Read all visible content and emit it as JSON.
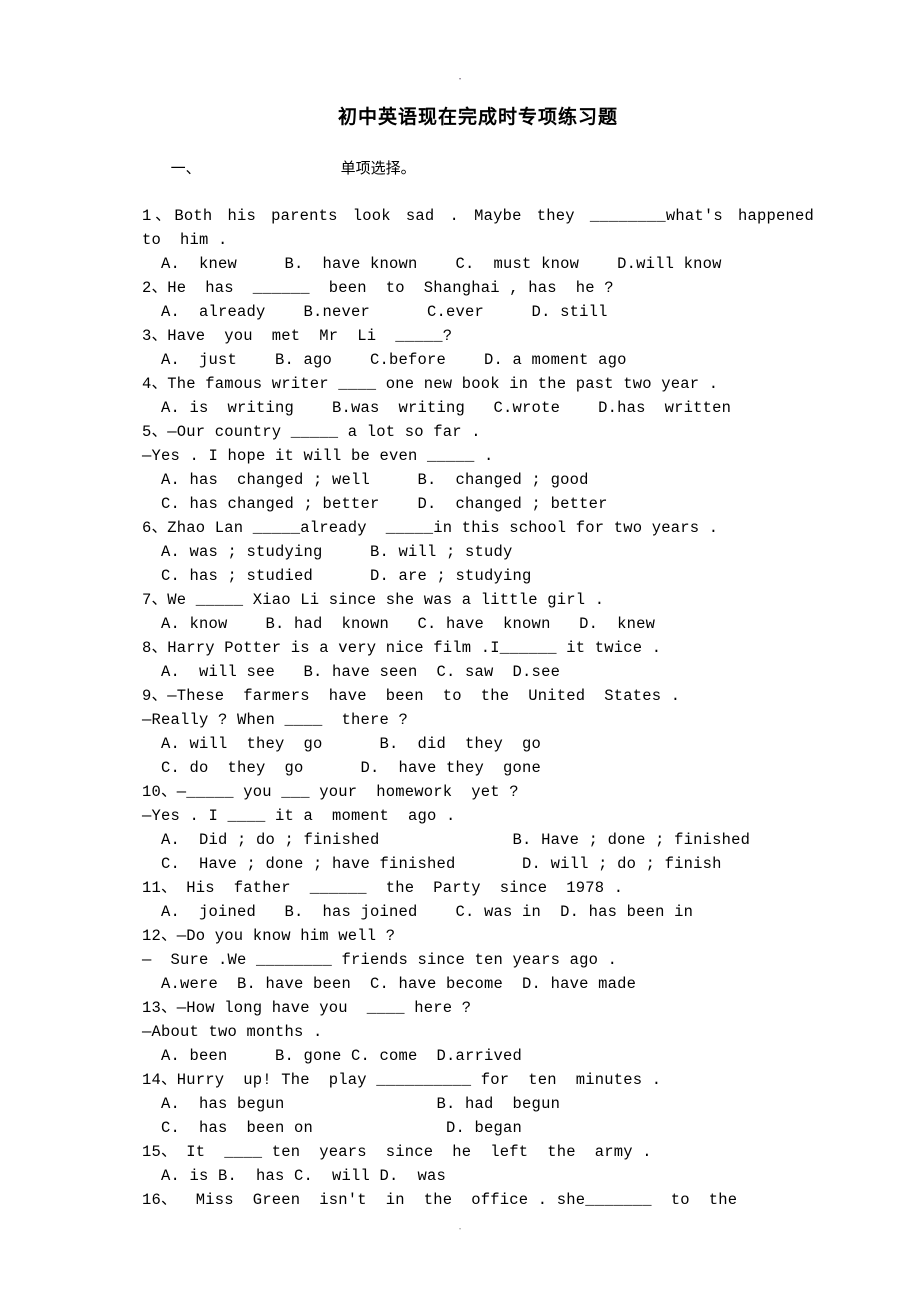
{
  "page": {
    "top_mark": "·",
    "bottom_mark": "·",
    "title": "初中英语现在完成时专项练习题",
    "section_number": "一、",
    "section_label": "单项选择。"
  },
  "questions": [
    {
      "number": "1、",
      "stem_line1": "1、Both  his  parents  look  sad . Maybe  they  ________what's  happened",
      "stem_line2": "to  him .",
      "options_lines": [
        "  A.  knew     B.  have known    C.  must know    D.will know"
      ]
    },
    {
      "number": "2、",
      "stem_line1": "2、He  has  ______  been  to  Shanghai , has  he ?",
      "options_lines": [
        "  A.  already    B.never      C.ever     D. still"
      ]
    },
    {
      "number": "3、",
      "stem_line1": "3、Have  you  met  Mr  Li  _____?",
      "options_lines": [
        "  A.  just    B. ago    C.before    D. a moment ago"
      ]
    },
    {
      "number": "4、",
      "stem_line1": "4、The famous writer ____ one new book in the past two year .",
      "options_lines": [
        "  A. is  writing    B.was  writing   C.wrote    D.has  written"
      ]
    },
    {
      "number": "5、",
      "stem_line1": "5、—Our country _____ a lot so far .",
      "stem_line2": "—Yes . I hope it will be even _____ .",
      "options_lines": [
        "  A. has  changed ; well     B.  changed ; good",
        "  C. has changed ; better    D.  changed ; better"
      ]
    },
    {
      "number": "6、",
      "stem_line1": "6、Zhao Lan _____already  _____in this school for two years .",
      "options_lines": [
        "  A. was ; studying     B. will ; study",
        "  C. has ; studied      D. are ; studying"
      ]
    },
    {
      "number": "7、",
      "stem_line1": "7、We _____ Xiao Li since she was a little girl .",
      "options_lines": [
        "  A. know    B. had  known   C. have  known   D.  knew"
      ]
    },
    {
      "number": "8、",
      "stem_line1": "8、Harry Potter is a very nice film .I______ it twice .",
      "options_lines": [
        "  A.  will see   B. have seen  C. saw  D.see"
      ]
    },
    {
      "number": "9、",
      "stem_line1": "9、—These  farmers  have  been  to  the  United  States .",
      "stem_line2": "—Really ? When ____  there ?",
      "options_lines": [
        "  A. will  they  go      B.  did  they  go",
        "  C. do  they  go      D.  have they  gone"
      ]
    },
    {
      "number": "10、",
      "stem_line1": "10、—_____ you ___ your  homework  yet ?",
      "stem_line2": "—Yes . I ____ it a  moment  ago .",
      "options_lines": [
        "  A.  Did ; do ; finished              B. Have ; done ; finished",
        "  C.  Have ; done ; have finished       D. will ; do ; finish"
      ]
    },
    {
      "number": "11、",
      "stem_line1": "11、 His  father  ______  the  Party  since  1978 .",
      "options_lines": [
        "  A.  joined   B.  has joined    C. was in  D. has been in"
      ]
    },
    {
      "number": "12、",
      "stem_line1": "12、—Do you know him well ?",
      "stem_line2": "—  Sure .We ________ friends since ten years ago .",
      "options_lines": [
        "  A.were  B. have been  C. have become  D. have made"
      ]
    },
    {
      "number": "13、",
      "stem_line1": "13、—How long have you  ____ here ?",
      "stem_line2": "—About two months .",
      "options_lines": [
        "  A. been     B. gone C. come  D.arrived"
      ]
    },
    {
      "number": "14、",
      "stem_line1": "14、Hurry  up! The  play __________ for  ten  minutes .",
      "options_lines": [
        "  A.  has begun                B. had  begun",
        "  C.  has  been on              D. began"
      ]
    },
    {
      "number": "15、",
      "stem_line1": "15、 It  ____ ten  years  since  he  left  the  army .",
      "options_lines": [
        "  A. is B.  has C.  will D.  was"
      ]
    },
    {
      "number": "16、",
      "stem_line1": "16、  Miss  Green  isn't  in  the  office . she_______  to  the",
      "options_lines": []
    }
  ]
}
